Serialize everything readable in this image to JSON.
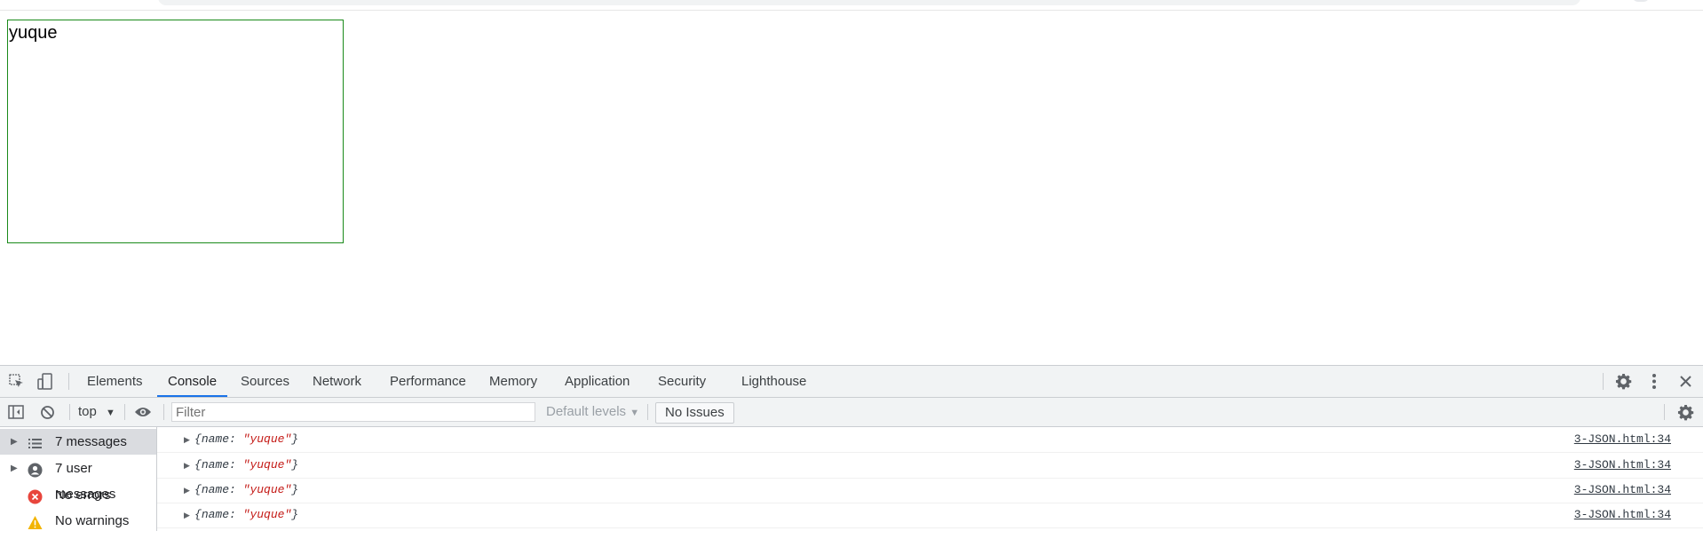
{
  "page": {
    "box_text": "yuque"
  },
  "devtools": {
    "tabs": [
      {
        "label": "Elements"
      },
      {
        "label": "Console"
      },
      {
        "label": "Sources"
      },
      {
        "label": "Network"
      },
      {
        "label": "Performance"
      },
      {
        "label": "Memory"
      },
      {
        "label": "Application"
      },
      {
        "label": "Security"
      },
      {
        "label": "Lighthouse"
      }
    ],
    "active_tab": "Console",
    "toolbar": {
      "context": "top",
      "filter_placeholder": "Filter",
      "levels": "Default levels",
      "issues": "No Issues"
    },
    "sidebar": [
      {
        "label": "7 messages",
        "icon": "list-icon"
      },
      {
        "label": "7 user messages",
        "icon": "user-icon"
      },
      {
        "label": "No errors",
        "icon": "error-icon"
      },
      {
        "label": "No warnings",
        "icon": "warning-icon"
      }
    ],
    "logs": [
      {
        "key": "name",
        "value": "\"yuque\"",
        "source": "3-JSON.html:34"
      },
      {
        "key": "name",
        "value": "\"yuque\"",
        "source": "3-JSON.html:34"
      },
      {
        "key": "name",
        "value": "\"yuque\"",
        "source": "3-JSON.html:34"
      },
      {
        "key": "name",
        "value": "\"yuque\"",
        "source": "3-JSON.html:34"
      }
    ]
  }
}
